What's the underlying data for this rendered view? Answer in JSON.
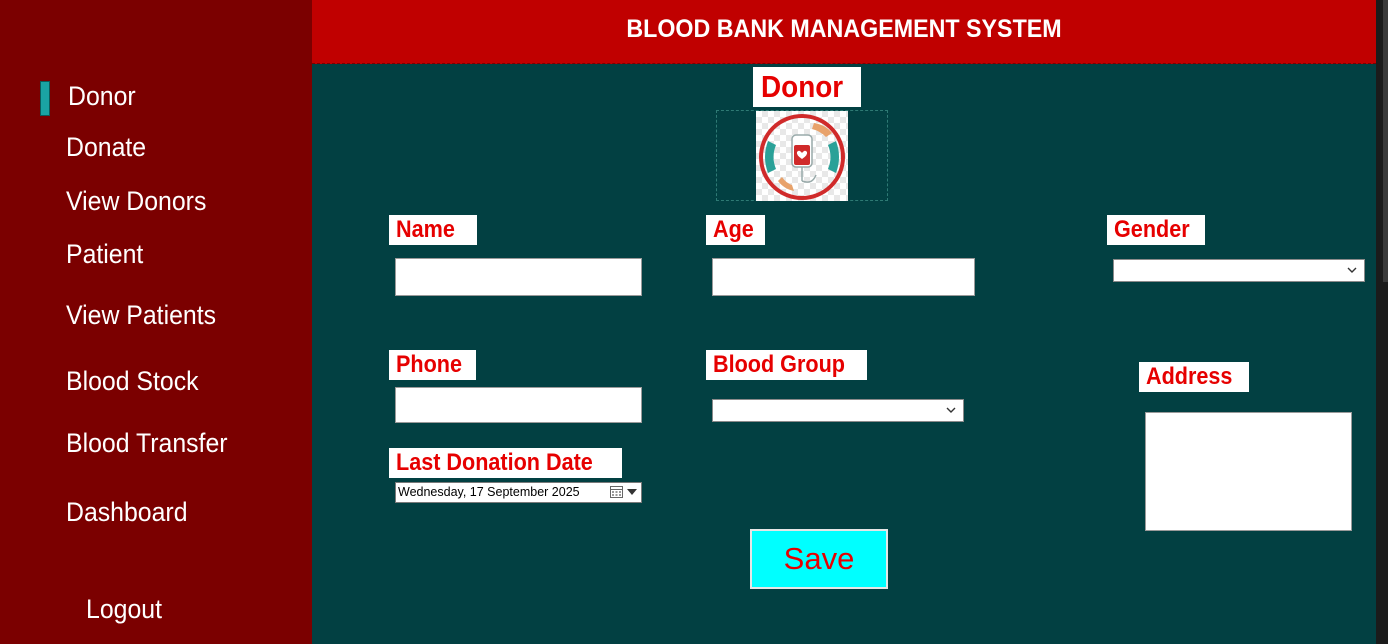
{
  "header": {
    "title": "BLOOD BANK MANAGEMENT SYSTEM"
  },
  "sidebar": {
    "items": [
      {
        "label": "Donor",
        "active": true
      },
      {
        "label": "Donate"
      },
      {
        "label": "View Donors"
      },
      {
        "label": "Patient"
      },
      {
        "label": "View Patients"
      },
      {
        "label": "Blood Stock"
      },
      {
        "label": "Blood Transfer"
      },
      {
        "label": "Dashboard"
      }
    ],
    "logout": "Logout"
  },
  "form": {
    "title": "Donor",
    "logo_icon": "blood-donation-logo-icon",
    "fields": {
      "name": {
        "label": "Name",
        "value": ""
      },
      "age": {
        "label": "Age",
        "value": ""
      },
      "gender": {
        "label": "Gender",
        "value": ""
      },
      "phone": {
        "label": "Phone",
        "value": ""
      },
      "blood_group": {
        "label": "Blood Group",
        "value": ""
      },
      "address": {
        "label": "Address",
        "value": ""
      },
      "last_donation_date": {
        "label": "Last Donation Date",
        "value": "Wednesday, 17 September 2025"
      }
    },
    "save_label": "Save"
  },
  "colors": {
    "sidebar_bg": "#7b0000",
    "header_bg": "#c00000",
    "main_bg": "#024042",
    "label_text": "#e60000",
    "save_bg": "#00ffff",
    "active_indicator": "#1aa3a3"
  }
}
